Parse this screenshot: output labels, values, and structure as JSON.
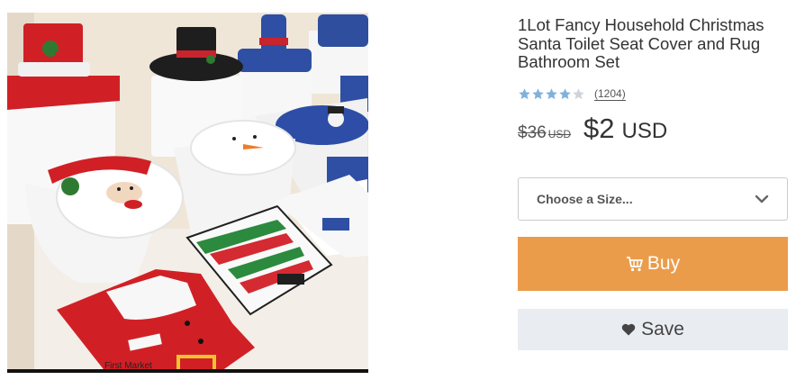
{
  "product": {
    "title": "1Lot Fancy Household Christmas Santa Toilet Seat Cover and Rug Bathroom Set",
    "image_watermark": "First Market",
    "rating": {
      "value": 4,
      "max": 5,
      "count": "(1204)"
    },
    "old_price": "$36",
    "old_currency": "USD",
    "new_price": "$2",
    "new_currency": "USD"
  },
  "size_select": {
    "placeholder": "Choose a Size...",
    "icon": "chevron-down-icon"
  },
  "buy_button": {
    "label": "Buy",
    "icon": "cart-icon",
    "color": "#eb9c4a"
  },
  "save_button": {
    "label": "Save",
    "icon": "heart-icon",
    "color": "#e9ecf0"
  },
  "colors": {
    "star_filled": "#7fb1dc",
    "star_empty": "#cfd4da"
  }
}
